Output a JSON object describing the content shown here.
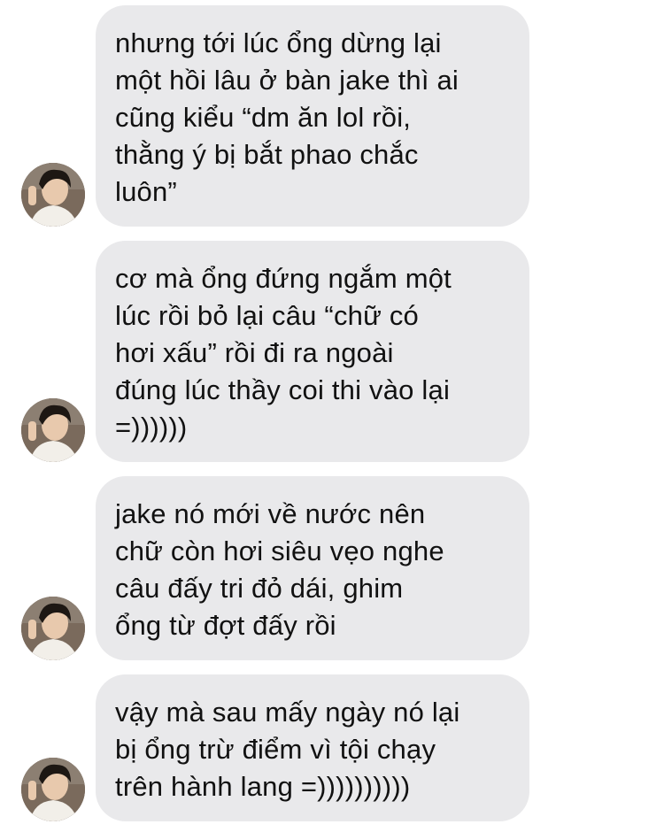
{
  "conversation": {
    "messages": [
      {
        "text": "nhưng tới lúc ổng dừng lại\nmột hồi lâu ở bàn jake thì ai\ncũng kiểu “dm ăn lol rồi,\nthằng ý bị bắt phao chắc\nluôn”",
        "avatar_icon": "profile-photo-avatar"
      },
      {
        "text": "cơ mà ổng đứng ngắm một\nlúc rồi bỏ lại câu “chữ có\nhơi xấu” rồi đi ra ngoài\nđúng lúc thầy coi thi vào lại\n=))))))",
        "avatar_icon": "profile-photo-avatar"
      },
      {
        "text": "jake nó mới về nước nên\nchữ còn hơi siêu vẹo nghe\ncâu đấy tri đỏ dái, ghim\nổng từ đợt đấy rồi",
        "avatar_icon": "profile-photo-avatar"
      },
      {
        "text": "vậy mà sau mấy ngày nó lại\nbị ổng trừ điểm vì tội chạy\ntrên hành lang =))))))))))",
        "avatar_icon": "profile-photo-avatar"
      }
    ]
  },
  "colors": {
    "bubble_background": "#e9e9eb",
    "text": "#111111",
    "page_background": "#ffffff"
  }
}
